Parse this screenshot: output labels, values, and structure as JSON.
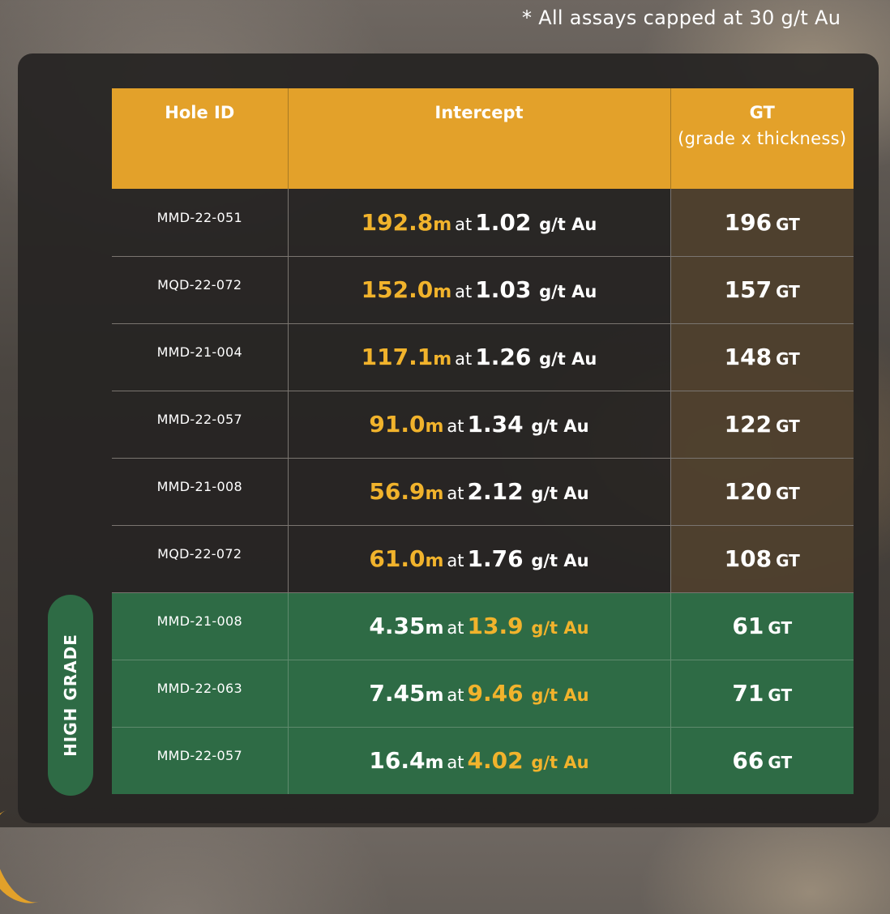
{
  "note": "* All assays capped at 30 g/t Au",
  "headers": {
    "hole_id": "Hole ID",
    "intercept": "Intercept",
    "gt": "GT",
    "gt_sub": "(grade x thickness)"
  },
  "high_grade_label": "HIGH GRADE",
  "words": {
    "at": "at",
    "unit": "g/t Au",
    "gt_unit": "GT"
  },
  "rows": [
    {
      "hole": "MMD-22-051",
      "length": "192.8",
      "len_unit": "m",
      "grade": "1.02",
      "gt": "196",
      "high_grade": false
    },
    {
      "hole": "MQD-22-072",
      "length": "152.0",
      "len_unit": "m",
      "grade": "1.03",
      "gt": "157",
      "high_grade": false
    },
    {
      "hole": "MMD-21-004",
      "length": "117.1",
      "len_unit": "m",
      "grade": "1.26",
      "gt": "148",
      "high_grade": false
    },
    {
      "hole": "MMD-22-057",
      "length": "91.0",
      "len_unit": "m",
      "grade": "1.34",
      "gt": "122",
      "high_grade": false
    },
    {
      "hole": "MMD-21-008",
      "length": "56.9",
      "len_unit": "m",
      "grade": "2.12",
      "gt": "120",
      "high_grade": false
    },
    {
      "hole": "MQD-22-072",
      "length": "61.0",
      "len_unit": "m",
      "grade": "1.76",
      "gt": "108",
      "high_grade": false
    },
    {
      "hole": "MMD-21-008",
      "length": "4.35",
      "len_unit": "m",
      "grade": "13.9",
      "gt": "61",
      "high_grade": true
    },
    {
      "hole": "MMD-22-063",
      "length": "7.45",
      "len_unit": "m",
      "grade": "9.46",
      "gt": "71",
      "high_grade": true
    },
    {
      "hole": "MMD-22-057",
      "length": "16.4",
      "len_unit": "m",
      "grade": "4.02",
      "gt": "66",
      "high_grade": true
    }
  ],
  "colors": {
    "header_bg": "#e3a12a",
    "accent_yellow": "#f1b32c",
    "high_grade_bg": "#2e6b45",
    "panel_bg": "#262422"
  }
}
